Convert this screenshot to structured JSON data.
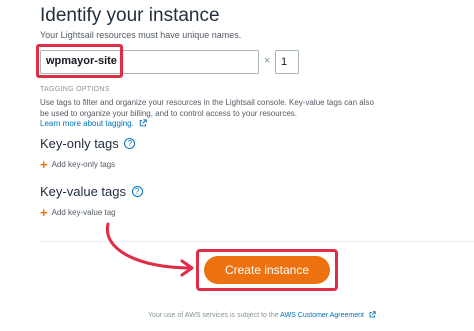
{
  "form": {
    "title": "Identify your instance",
    "subtitle": "Your Lightsail resources must have unique names.",
    "name_value": "wpmayor-site",
    "times_symbol": "×",
    "quantity_value": "1"
  },
  "tagging": {
    "label": "TAGGING OPTIONS",
    "description": "Use tags to filter and organize your resources in the Lightsail console. Key-value tags can also be used to organize your billing, and to control access to your resources.",
    "learn_more": "Learn more about tagging."
  },
  "key_only": {
    "title": "Key-only tags",
    "add_label": "Add key-only tags"
  },
  "key_value": {
    "title": "Key-value tags",
    "add_label": "Add key-value tag"
  },
  "actions": {
    "create_label": "Create instance"
  },
  "footer": {
    "text": "Your use of AWS services is subject to the",
    "link": "AWS Customer Agreement",
    "end": "."
  },
  "colors": {
    "accent": "#ec7211",
    "link": "#0073bb",
    "annotation": "#e02c46"
  },
  "icons": [
    "help-icon",
    "plus-icon",
    "external-link-icon",
    "annotation-arrow"
  ]
}
